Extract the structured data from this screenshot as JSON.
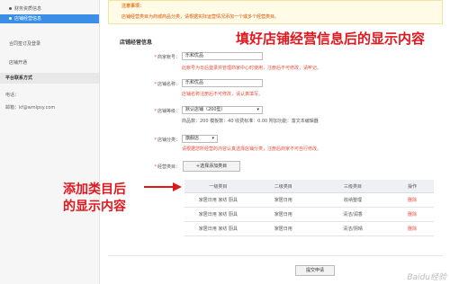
{
  "sidebar": {
    "items": [
      {
        "label": "财务资质信息"
      },
      {
        "label": "店铺经营信息"
      },
      {
        "label": "合同签订及登录"
      },
      {
        "label": "店铺开通"
      }
    ],
    "contact": {
      "heading": "平台联系方式",
      "phone_label": "电话：",
      "email_label": "邮箱：kf@wmlpsy.com"
    }
  },
  "notice": {
    "title": "注意事项：",
    "text": "店铺经营类目为商城商品分类，请根据实际运营情况添加一个或多个经营类目。"
  },
  "section_title": "店铺经营信息",
  "annotations": {
    "top": "填好店铺经营信息后的显示内容",
    "left_line1": "添加类目后",
    "left_line2": "的显示内容"
  },
  "form": {
    "account": {
      "label": "商家帐号：",
      "value": "乐和优品",
      "hint": "此帐号为日后登录并管理商家中心时使用，注册后不可修改，请牢记。"
    },
    "shop_name": {
      "label": "店铺名称：",
      "value": "乐和优品",
      "hint": "店铺名称注册后不可修改，请认真填写。"
    },
    "shop_level": {
      "label": "店铺等级：",
      "value": "默认店铺（200型）",
      "info": "商品数：200 模板数：40 收费标准：0.00 附加功能：富文本编辑器"
    },
    "shop_category": {
      "label": "店铺分类：",
      "value": "旗舰店",
      "hint": "请根据您所经营的内容认真选择店铺分类，注册后商家不可自行修改。"
    },
    "biz_category": {
      "label": "经营类目：",
      "button": "+选择添加类目"
    }
  },
  "table": {
    "headers": [
      "一级类目",
      "二级类目",
      "三级类目",
      "操作"
    ],
    "rows": [
      [
        "家居日用 家纺 厨具",
        "家居日用",
        "收纳整理",
        "删除"
      ],
      [
        "家居日用 家纺 厨具",
        "家居日用",
        "清洁/润香",
        "删除"
      ],
      [
        "家居日用 家纺 厨具",
        "家居日用",
        "清洁/阴晴",
        "删除"
      ]
    ]
  },
  "submit_label": "提交申请",
  "watermark": "Baidu经验"
}
